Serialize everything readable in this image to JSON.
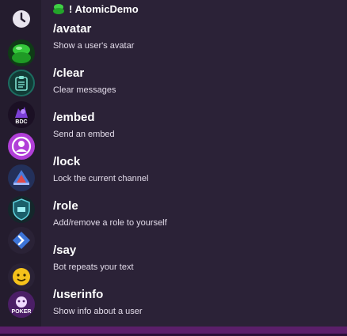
{
  "header": {
    "title": "! AtomicDemo",
    "bot_icon": "green-blob-icon"
  },
  "commands": [
    {
      "name": "/avatar",
      "description": "Show a user's avatar"
    },
    {
      "name": "/clear",
      "description": "Clear messages"
    },
    {
      "name": "/embed",
      "description": "Send an embed"
    },
    {
      "name": "/lock",
      "description": "Lock the current channel"
    },
    {
      "name": "/role",
      "description": "Add/remove a role to yourself"
    },
    {
      "name": "/say",
      "description": "Bot repeats your text"
    },
    {
      "name": "/userinfo",
      "description": "Show info about a user"
    }
  ],
  "sidebar": {
    "items": [
      {
        "icon": "clock-icon",
        "label": ""
      },
      {
        "icon": "green-blob-server-icon",
        "label": ""
      },
      {
        "icon": "clipboard-server-icon",
        "label": ""
      },
      {
        "icon": "bdc-server-icon",
        "label": "BDC"
      },
      {
        "icon": "user-circle-server-icon",
        "label": ""
      },
      {
        "icon": "ship-server-icon",
        "label": ""
      },
      {
        "icon": "shield-server-icon",
        "label": ""
      },
      {
        "icon": "diamond-arrow-server-icon",
        "label": ""
      },
      {
        "icon": "emoji-server-icon",
        "label": ""
      },
      {
        "icon": "poker-server-icon",
        "label": "POKER"
      }
    ]
  },
  "colors": {
    "panel_bg": "#2b2237",
    "sidebar_bg": "#241c2e",
    "accent_purple": "#5b1f6a"
  }
}
